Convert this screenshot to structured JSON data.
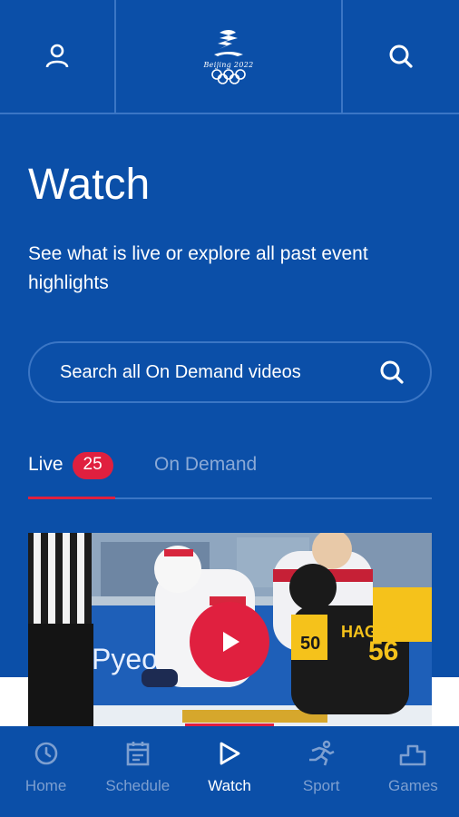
{
  "header": {
    "profile_icon": "person-icon",
    "logo_text": "Beijing 2022",
    "search_icon": "search-icon"
  },
  "main": {
    "title": "Watch",
    "subtitle": "See what is live or explore all past event highlights",
    "search_label": "Search all On Demand videos",
    "tabs": {
      "live_label": "Live",
      "live_count": "25",
      "on_demand_label": "On Demand"
    },
    "video": {
      "play_icon": "play-icon",
      "banner_text": "Pyeong",
      "jersey_number_1": "50",
      "jersey_name": "HAGER",
      "jersey_number_2": "56"
    }
  },
  "bottom_nav": {
    "items": [
      {
        "label": "Home",
        "icon": "clock-icon"
      },
      {
        "label": "Schedule",
        "icon": "calendar-icon"
      },
      {
        "label": "Watch",
        "icon": "play-outline-icon"
      },
      {
        "label": "Sport",
        "icon": "runner-icon"
      },
      {
        "label": "Games",
        "icon": "podium-icon"
      }
    ]
  },
  "colors": {
    "background": "#0b4fa8",
    "accent": "#e0203f",
    "divider": "#3b76c5",
    "inactive": "#7d9fd0"
  }
}
